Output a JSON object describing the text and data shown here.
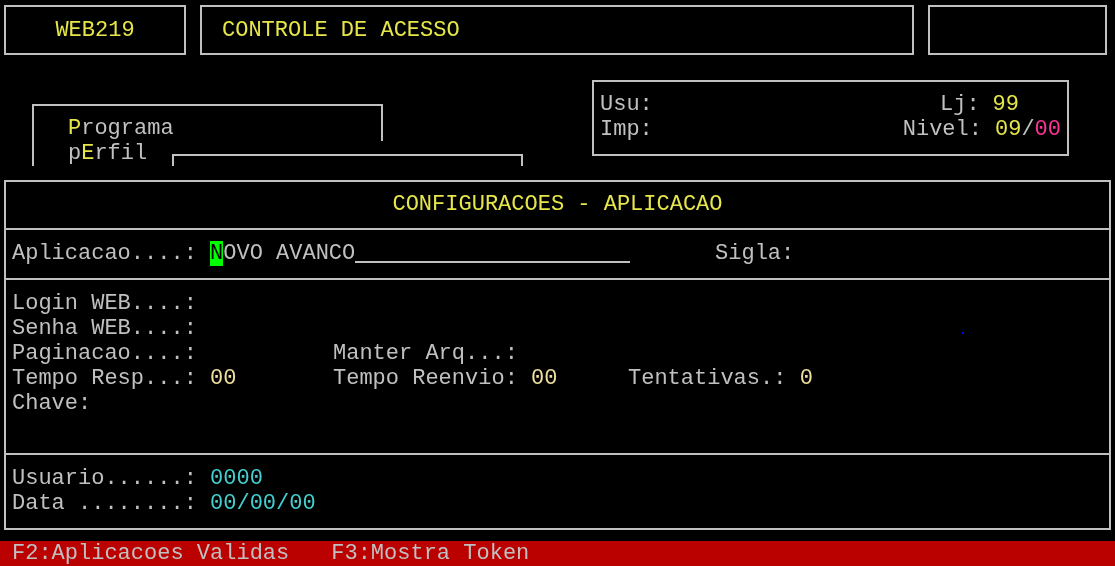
{
  "program_code": "WEB219",
  "title": "CONTROLE DE ACESSO",
  "menu": [
    {
      "parts": [
        {
          "text": "P",
          "hotkey": true
        },
        {
          "text": "rograma",
          "hotkey": false
        }
      ]
    },
    {
      "parts": [
        {
          "text": "p",
          "hotkey": false
        },
        {
          "text": "E",
          "hotkey": true
        },
        {
          "text": "rfil",
          "hotkey": false
        }
      ]
    }
  ],
  "session": {
    "usu_label": "Usu:",
    "imp_label": "Imp:",
    "lj_label": "Lj:",
    "lj_value": "99",
    "nivel_label": "Nivel:",
    "nivel_parts": [
      {
        "text": "09",
        "color": "#e6e64a"
      },
      {
        "text": "/",
        "color": "#c0c0c0"
      },
      {
        "text": "00",
        "color": "#ff3399"
      }
    ]
  },
  "panel": {
    "title": "CONFIGURACOES - APLICACAO",
    "application": {
      "label": "Aplicacao....:",
      "value": "NOVO AVANCO",
      "cursor": true
    },
    "sigla": {
      "label": "Sigla:"
    },
    "fields": [
      [
        {
          "label": "Login WEB....:"
        }
      ],
      [
        {
          "label": "Senha WEB....:"
        }
      ],
      [
        {
          "label": "Paginacao....:"
        },
        {
          "label": "Manter Arq...:"
        }
      ],
      [
        {
          "label": "Tempo Resp...:",
          "value": "00"
        },
        {
          "label": "Tempo Reenvio:",
          "value": "00"
        },
        {
          "label": "Tentativas.:",
          "value": "0"
        }
      ],
      [
        {
          "label": "Chave:"
        }
      ]
    ],
    "audit": [
      {
        "label": "Usuario......:",
        "value": "0000"
      },
      {
        "label": "Data ........:",
        "value": "00/00/00"
      }
    ]
  },
  "function_keys": [
    "F2:Aplicacoes Validas",
    "F3:Mostra Token"
  ]
}
